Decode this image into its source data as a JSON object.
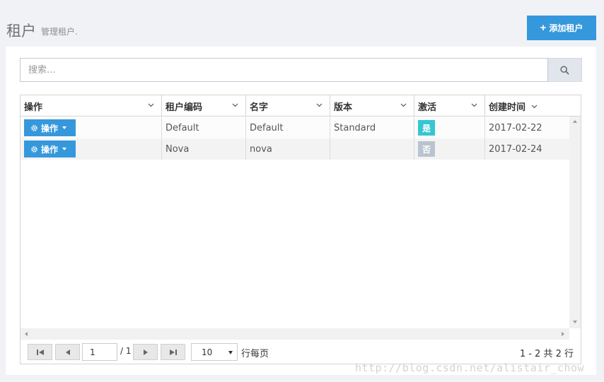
{
  "header": {
    "title": "租户",
    "subtitle": "管理租户.",
    "add_button_label": "添加租户"
  },
  "search": {
    "placeholder": "搜索..."
  },
  "table": {
    "columns": [
      {
        "label": "操作"
      },
      {
        "label": "租户编码"
      },
      {
        "label": "名字"
      },
      {
        "label": "版本"
      },
      {
        "label": "激活"
      },
      {
        "label": "创建时间"
      }
    ],
    "action_button_label": "操作",
    "rows": [
      {
        "code": "Default",
        "name": "Default",
        "edition": "Standard",
        "active": "是",
        "created": "2017-02-22"
      },
      {
        "code": "Nova",
        "name": "nova",
        "edition": "",
        "active": "否",
        "created": "2017-02-24"
      }
    ]
  },
  "pager": {
    "current_page": "1",
    "total_pages": "/ 1",
    "page_size": "10",
    "per_page_label": "行每页",
    "range_text": "1 - 2 共 2 行"
  },
  "watermark": "http://blog.csdn.net/alistair_chow",
  "colors": {
    "primary": "#3598dc",
    "active_badge": "#36c6d3",
    "inactive_badge": "#bac3d0"
  }
}
